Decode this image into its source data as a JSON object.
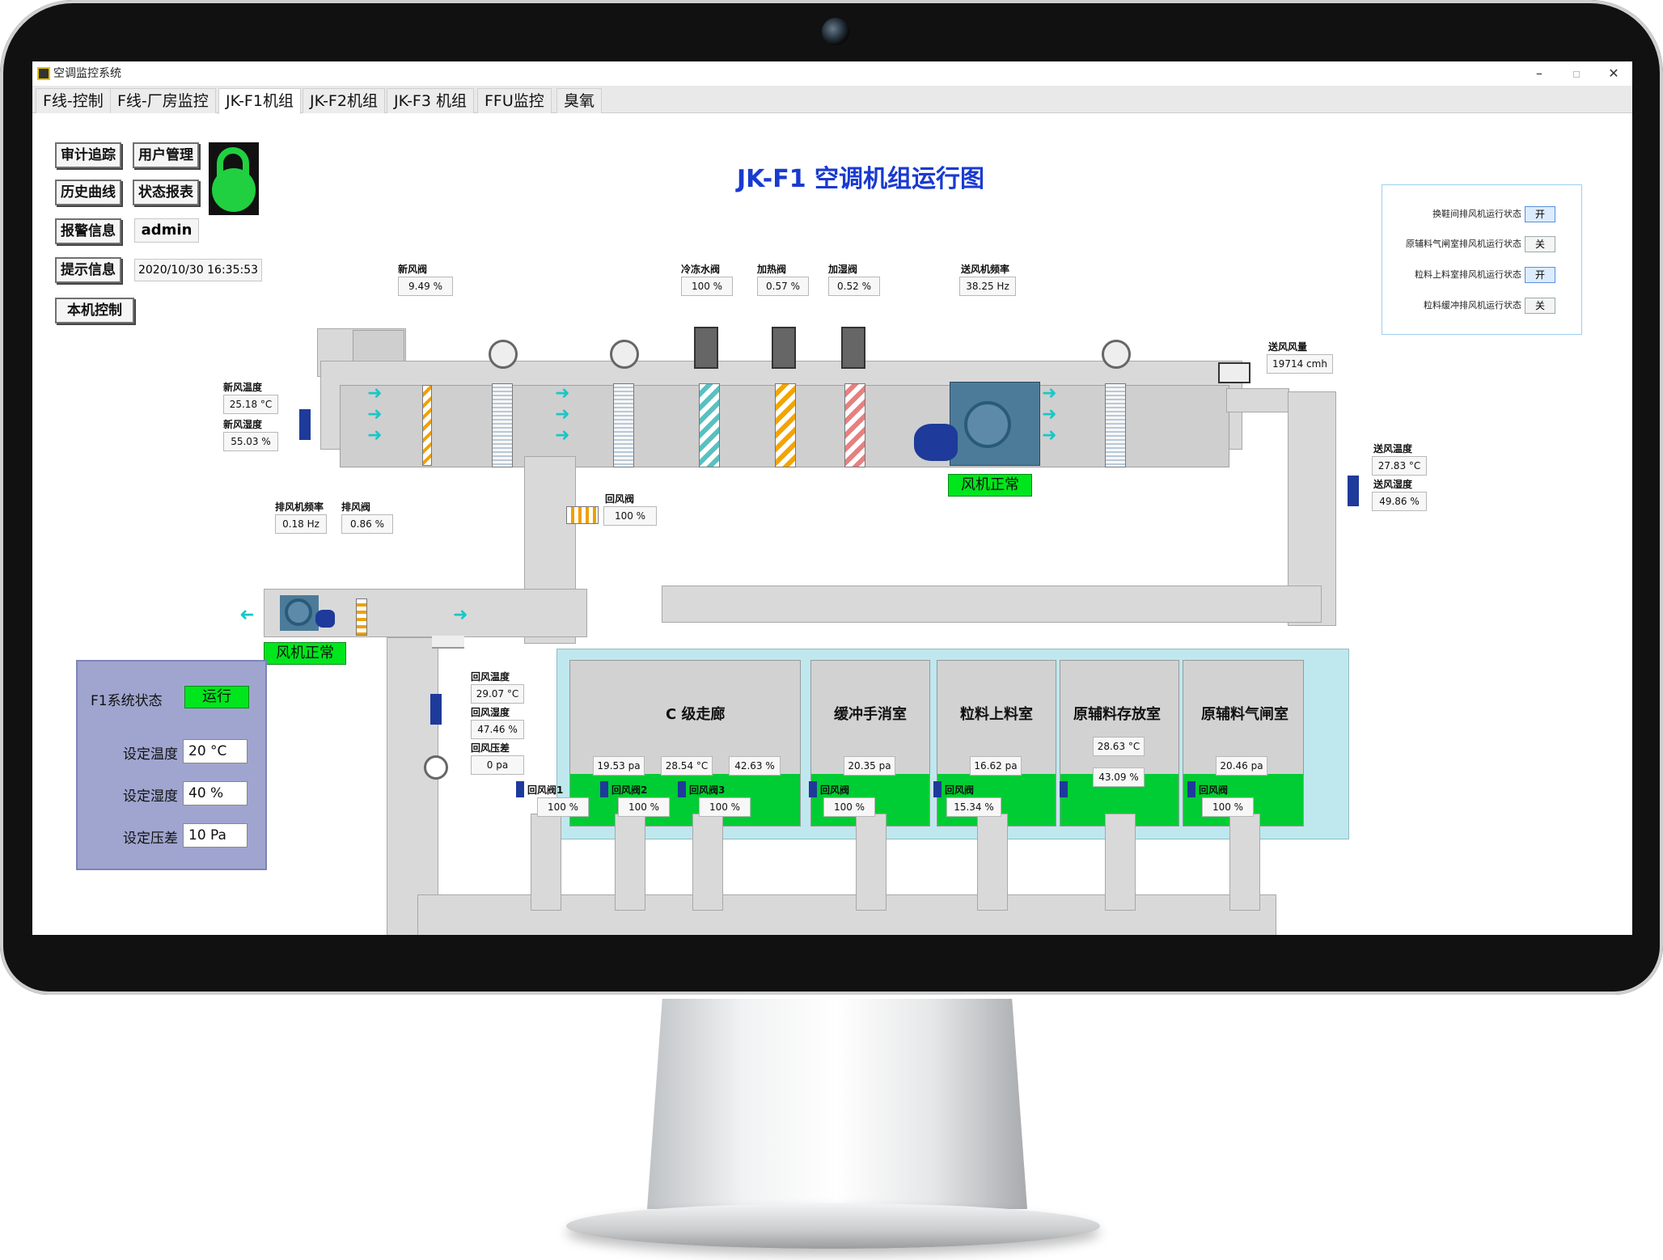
{
  "window": {
    "title": "空调监控系统",
    "min": "–",
    "max": "▫",
    "close": "✕"
  },
  "tabs": [
    "F线-控制",
    "F线-厂房监控",
    "JK-F1机组",
    "JK-F2机组",
    "JK-F3 机组",
    "FFU监控",
    "臭氧"
  ],
  "active_tab": 2,
  "buttons": {
    "audit": "审计追踪",
    "users": "用户管理",
    "history": "历史曲线",
    "report": "状态报表",
    "alarm": "报警信息",
    "hint": "提示信息",
    "local": "本机控制"
  },
  "user": "admin",
  "datetime": "2020/10/30  16:35:53",
  "diagram_title": "JK-F1 空调机组运行图",
  "legend": [
    {
      "label": "换鞋间排风机运行状态",
      "value": "开",
      "on": true
    },
    {
      "label": "原辅料气闸室排风机运行状态",
      "value": "关",
      "on": false
    },
    {
      "label": "粒料上料室排风机运行状态",
      "value": "开",
      "on": true
    },
    {
      "label": "粒料缓冲排风机运行状态",
      "value": "关",
      "on": false
    }
  ],
  "top_sensors": {
    "fresh_damper": {
      "label": "新风阀",
      "value": "9.49 %"
    },
    "chill_valve": {
      "label": "冷冻水阀",
      "value": "100 %"
    },
    "heat_valve": {
      "label": "加热阀",
      "value": "0.57 %"
    },
    "humid_valve": {
      "label": "加湿阀",
      "value": "0.52 %"
    },
    "supply_freq": {
      "label": "送风机频率",
      "value": "38.25 Hz"
    },
    "supply_flow": {
      "label": "送风风量",
      "value": "19714 cmh"
    }
  },
  "fresh_air": {
    "temp_label": "新风温度",
    "temp": "25.18 °C",
    "hum_label": "新风湿度",
    "hum": "55.03 %"
  },
  "supply_air": {
    "temp_label": "送风温度",
    "temp": "27.83 °C",
    "hum_label": "送风湿度",
    "hum": "49.86 %"
  },
  "exhaust": {
    "freq_label": "排风机频率",
    "freq": "0.18 Hz",
    "damper_label": "排风阀",
    "damper": "0.86 %"
  },
  "return_damper": {
    "label": "回风阀",
    "value": "100 %"
  },
  "return_air": {
    "temp_label": "回风温度",
    "temp": "29.07 °C",
    "hum_label": "回风湿度",
    "hum": "47.46 %",
    "dp_label": "回风压差",
    "dp": "0 pa"
  },
  "fan_status": {
    "supply": "风机正常",
    "exhaust": "风机正常"
  },
  "rooms": [
    {
      "name": "C 级走廊",
      "values": [
        "19.53 pa",
        "28.54 °C",
        "42.63 %"
      ]
    },
    {
      "name": "缓冲手消室",
      "values": [
        "20.35 pa"
      ]
    },
    {
      "name": "粒料上料室",
      "values": [
        "16.62 pa"
      ]
    },
    {
      "name": "原辅料存放室",
      "values": [
        "28.63 °C",
        "43.09 %"
      ]
    },
    {
      "name": "原辅料气闸室",
      "values": [
        "20.46 pa"
      ]
    }
  ],
  "return_dampers": [
    {
      "label": "回风阀1",
      "value": "100 %"
    },
    {
      "label": "回风阀2",
      "value": "100 %"
    },
    {
      "label": "回风阀3",
      "value": "100 %"
    },
    {
      "label": "回风阀",
      "value": "100 %"
    },
    {
      "label": "回风阀",
      "value": "15.34 %"
    },
    {
      "label": "回风阀",
      "value": "100 %"
    }
  ],
  "system": {
    "status_label": "F1系统状态",
    "status": "运行",
    "temp_label": "设定温度",
    "temp": "20 °C",
    "hum_label": "设定湿度",
    "hum": "40 %",
    "dp_label": "设定压差",
    "dp": "10 Pa"
  },
  "colors": {
    "accent_title": "#1a3ad0",
    "ok": "#00e61c",
    "room_floor": "#00cc33",
    "arrow": "#19c7c7"
  }
}
